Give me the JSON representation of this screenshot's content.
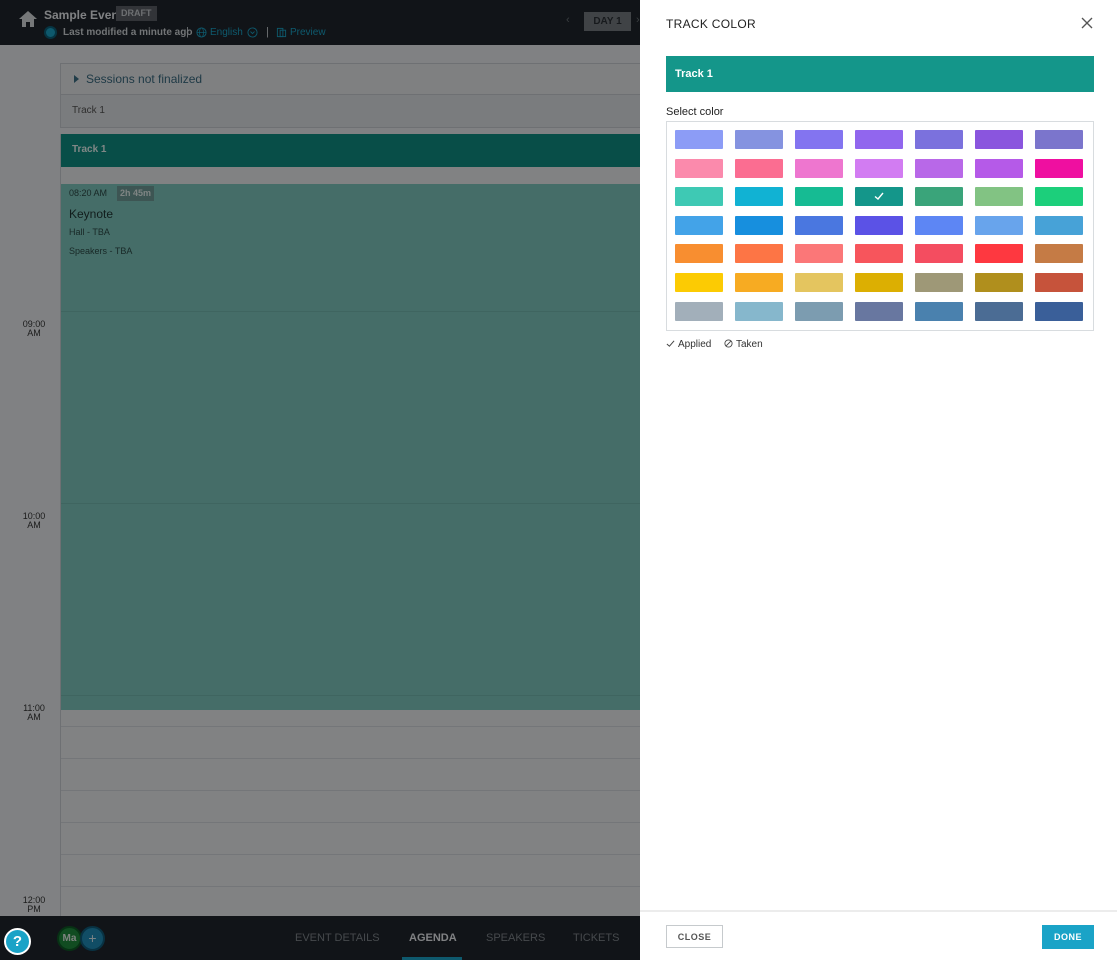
{
  "header": {
    "event_title": "Sample Event",
    "status_badge": "DRAFT",
    "last_modified": "Last modified a minute ago",
    "separator": "|",
    "language": "English",
    "preview_label": "Preview",
    "day_label": "DAY 1"
  },
  "agenda": {
    "unfinalized_label": "Sessions not finalized",
    "track_row_label": "Track 1",
    "track_header_label": "Track 1",
    "session": {
      "start_time": "08:20 AM",
      "duration": "2h 45m",
      "title": "Keynote",
      "hall": "Hall - TBA",
      "speakers": "Speakers - TBA"
    },
    "time_labels": [
      {
        "hour": "09:00",
        "meridiem": "AM"
      },
      {
        "hour": "10:00",
        "meridiem": "AM"
      },
      {
        "hour": "11:00",
        "meridiem": "AM"
      },
      {
        "hour": "12:00",
        "meridiem": "PM"
      }
    ]
  },
  "bottom_nav": {
    "help_label": "?",
    "avatar_initials": "Ma",
    "add_label": "+",
    "tabs": [
      {
        "label": "EVENT DETAILS",
        "active": false
      },
      {
        "label": "AGENDA",
        "active": true
      },
      {
        "label": "SPEAKERS",
        "active": false
      },
      {
        "label": "TICKETS",
        "active": false
      }
    ]
  },
  "drawer": {
    "title": "TRACK COLOR",
    "track_name": "Track 1",
    "selected_color": "#14968a",
    "select_label": "Select color",
    "legend": {
      "applied": "Applied",
      "taken": "Taken"
    },
    "close_button": "CLOSE",
    "done_button": "DONE",
    "swatch_rows": [
      [
        "#8c9cf6",
        "#8593e0",
        "#8374f0",
        "#9166ee",
        "#7b71dd",
        "#8a55de",
        "#7b75cc"
      ],
      [
        "#fb8aac",
        "#fb6d91",
        "#ee76cf",
        "#d27cf2",
        "#b868e8",
        "#b55ae8",
        "#ef0fa0"
      ],
      [
        "#3ec9b4",
        "#11b2d3",
        "#16bb93",
        "#14968a",
        "#3aa47a",
        "#82c383",
        "#1ccf7b"
      ],
      [
        "#43a3e8",
        "#178fde",
        "#4a77e0",
        "#5b52e6",
        "#5d86f4",
        "#68a4ec",
        "#47a2d7"
      ],
      [
        "#f88e30",
        "#fd7545",
        "#fb7778",
        "#f7555c",
        "#f44d60",
        "#fe3840",
        "#c57b45"
      ],
      [
        "#fccb03",
        "#f7ab22",
        "#e4c55f",
        "#dcaf02",
        "#9e9877",
        "#b08f1d",
        "#c6533b"
      ],
      [
        "#a2afba",
        "#86b7cc",
        "#7c9cb0",
        "#6877a0",
        "#4a81ae",
        "#4b6c94",
        "#3a5f99"
      ]
    ]
  }
}
